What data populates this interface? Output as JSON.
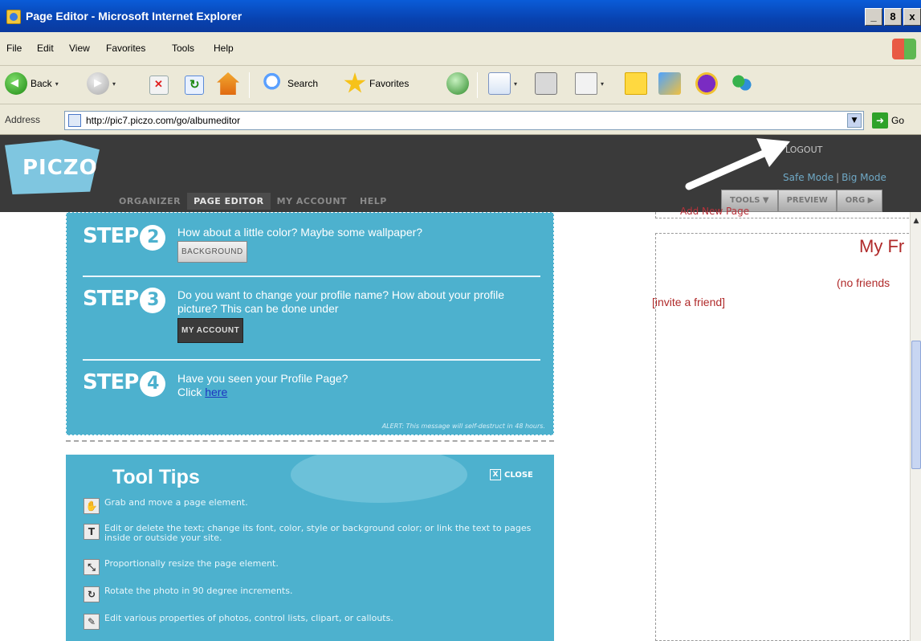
{
  "window": {
    "title": "Page Editor - Microsoft Internet Explorer",
    "btn_min": "_",
    "btn_max": "8",
    "btn_close": "x"
  },
  "menu": {
    "items": [
      "File",
      "Edit",
      "View",
      "Favorites",
      "Tools",
      "Help"
    ]
  },
  "toolbar": {
    "back": "Back",
    "search": "Search",
    "favorites": "Favorites",
    "dd": "▾"
  },
  "address": {
    "label": "Address",
    "url": "http://pic7.piczo.com/go/albumeditor",
    "go": "Go",
    "drop": "▼",
    "go_arrow": "➜"
  },
  "piczo": {
    "logo": "PICZO",
    "logout": "LOGOUT",
    "safe_mode": "Safe Mode",
    "big_mode": "Big Mode",
    "pipe": "|",
    "nav": [
      "ORGANIZER",
      "PAGE EDITOR",
      "MY ACCOUNT",
      "HELP"
    ],
    "tabs": [
      "TOOLS ▼",
      "PREVIEW",
      "ORG ▶"
    ]
  },
  "steps": {
    "step_word": "STEP",
    "step2": {
      "num": "2",
      "text": "How about a little color? Maybe some wallpaper?",
      "button": "BACKGROUND"
    },
    "step3": {
      "num": "3",
      "text": "Do you want to change your profile name? How about your profile picture? This can be done under",
      "button": "MY ACCOUNT"
    },
    "step4": {
      "num": "4",
      "text": "Have you seen your Profile Page?",
      "click": "Click",
      "link": "here"
    },
    "alert": "ALERT: This message will self-destruct in 48 hours."
  },
  "tooltips": {
    "title": "Tool Tips",
    "close": "CLOSE",
    "close_x": "X",
    "items": [
      {
        "icon": "✋",
        "text": "Grab and move a page element."
      },
      {
        "icon": "T",
        "text": "Edit or delete the text; change its font, color, style or background color; or link the text to pages inside or outside your site."
      },
      {
        "icon": "⤡",
        "text": "Proportionally resize the page element."
      },
      {
        "icon": "↻",
        "text": "Rotate the photo in 90 degree increments."
      },
      {
        "icon": "✎",
        "text": "Edit various properties of photos, control lists, clipart, or callouts."
      }
    ]
  },
  "friends": {
    "partial": "Add New Page",
    "title": "My Fr",
    "none": "(no friends",
    "invite": "[invite a friend]"
  },
  "scroll": {
    "up": "▲"
  }
}
